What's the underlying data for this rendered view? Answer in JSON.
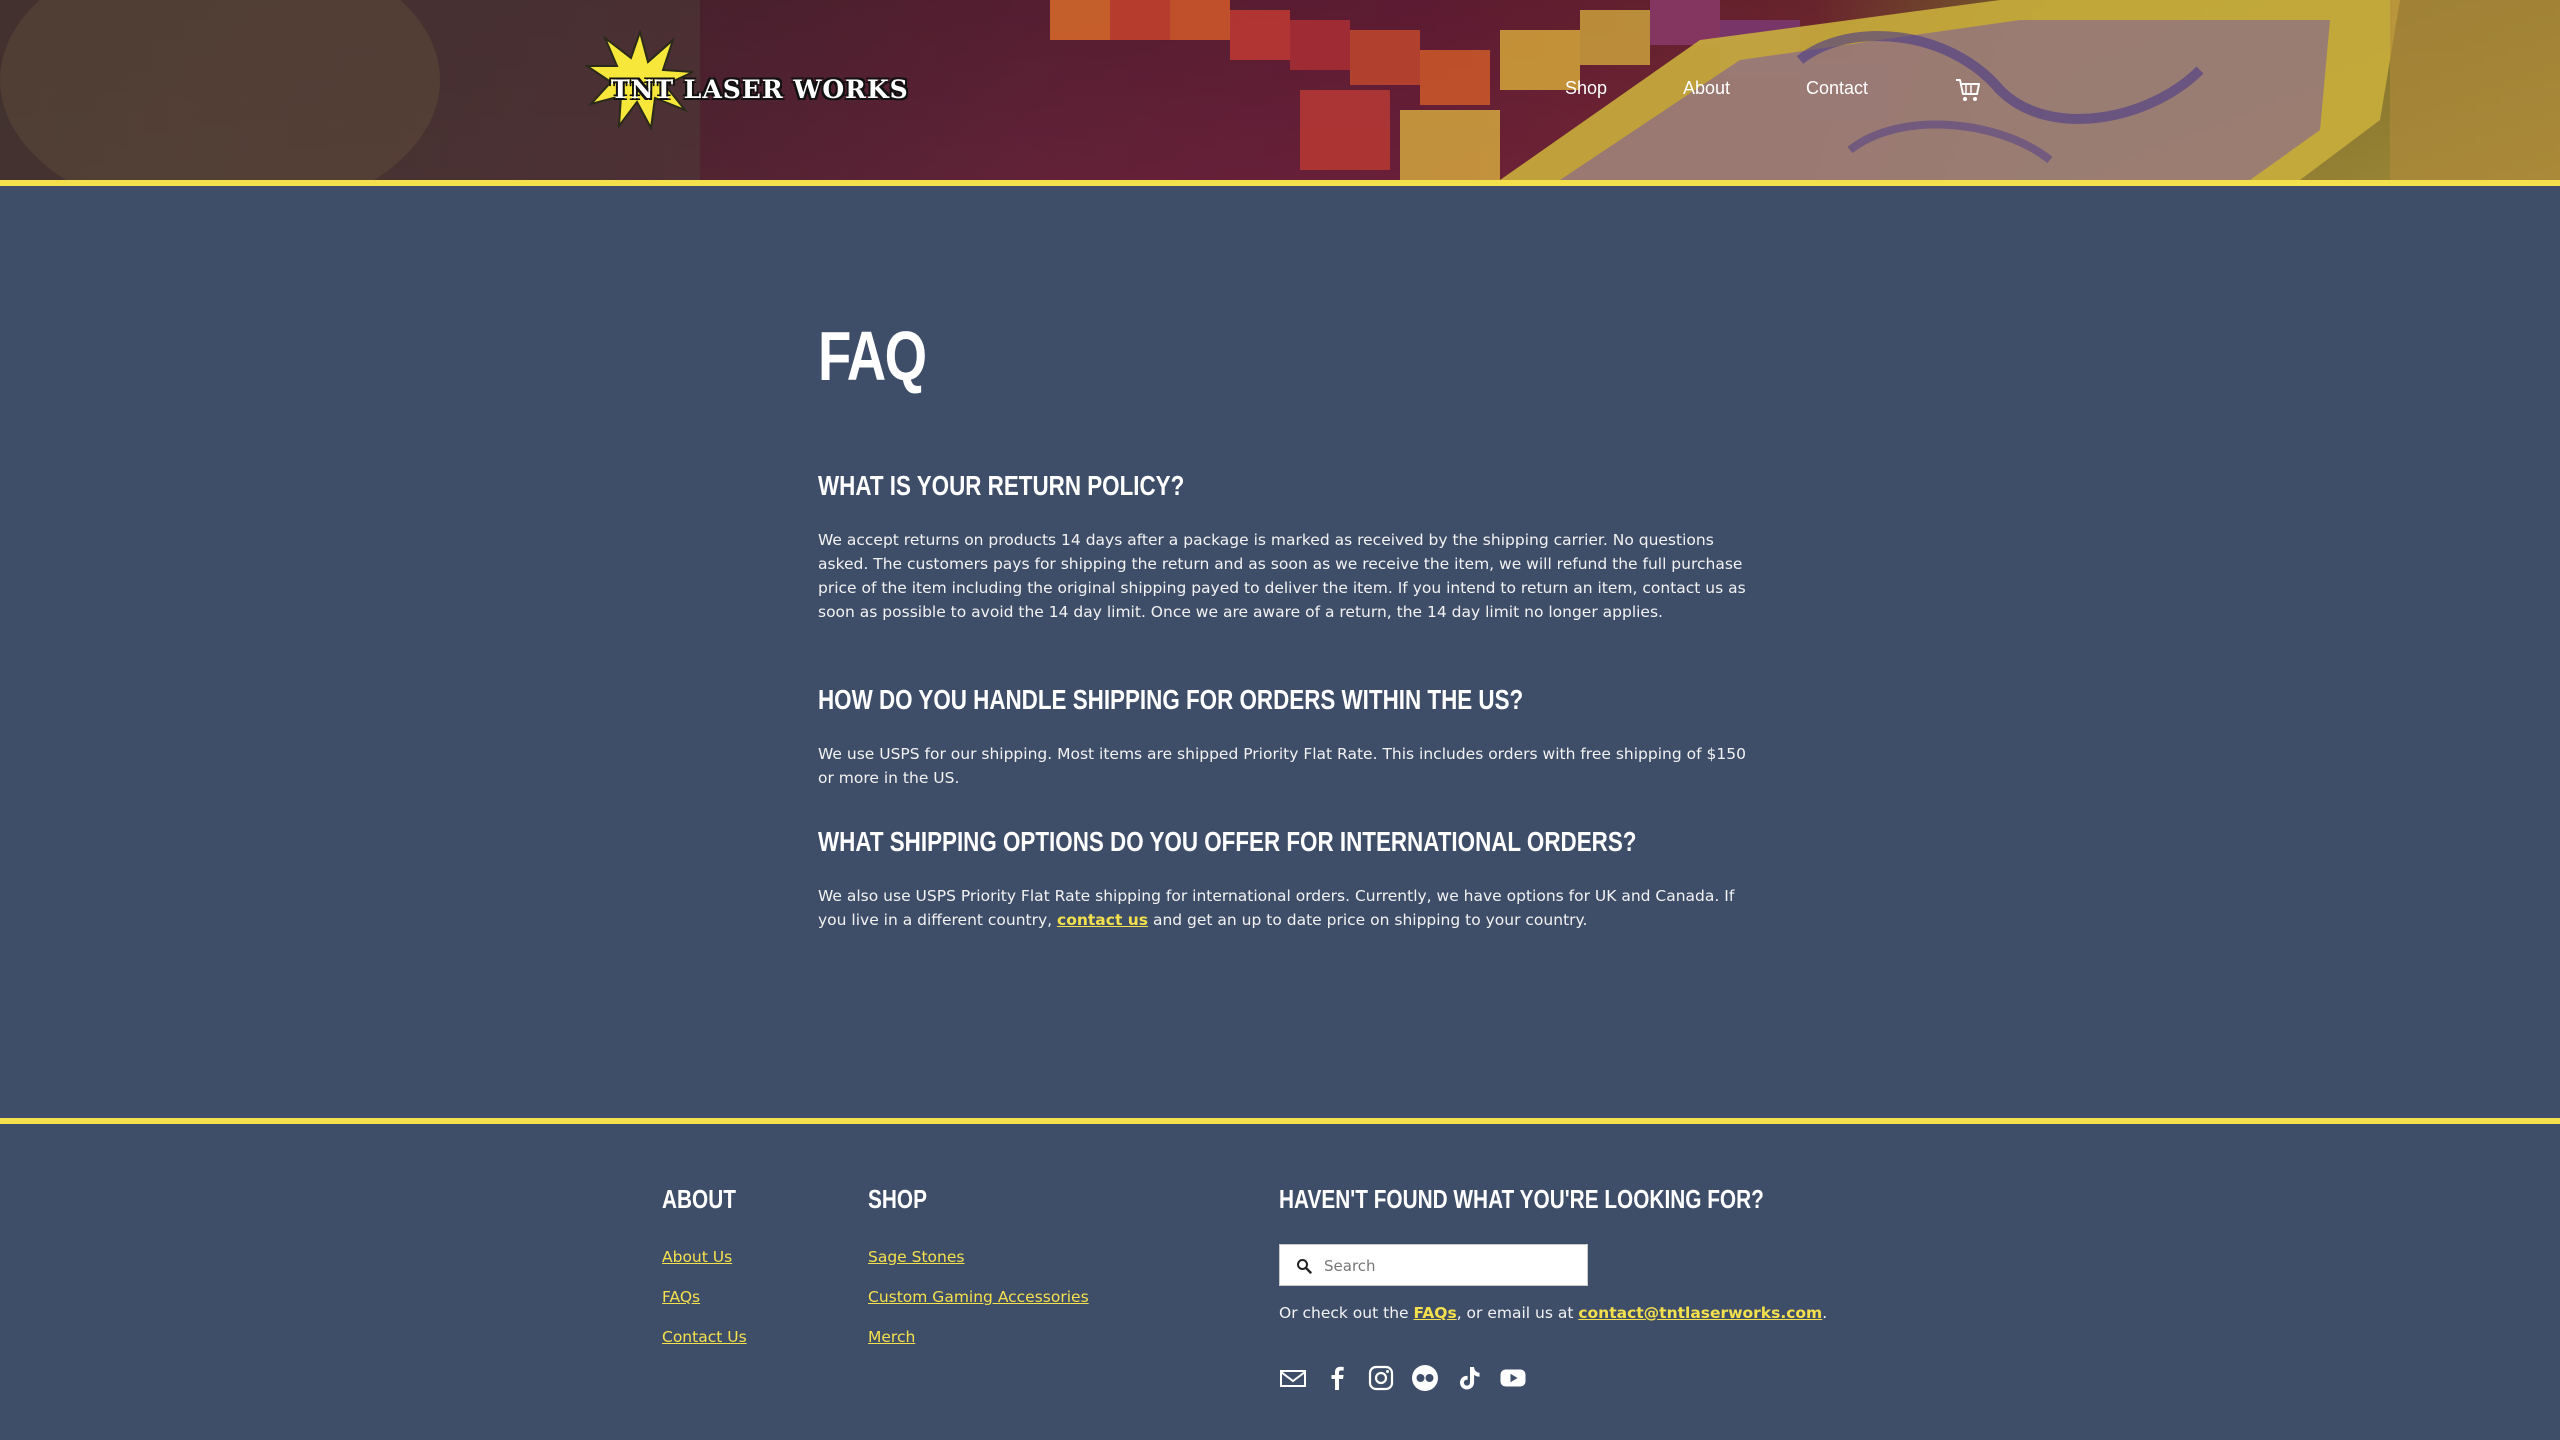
{
  "header": {
    "logo_text": "TNT LASER WORKS",
    "nav": [
      {
        "label": "Shop"
      },
      {
        "label": "About"
      },
      {
        "label": "Contact"
      }
    ],
    "cart_icon": "shopping-cart-icon"
  },
  "main": {
    "title": "FAQ",
    "faqs": [
      {
        "question": "WHAT IS YOUR RETURN POLICY?",
        "answer": "We accept returns on products 14 days after a package is marked as received by the shipping carrier. No questions asked. The customers pays for shipping the return and as soon as we receive the item, we will refund the full purchase price of the item including the original shipping payed to deliver the item. If you intend to return an item, contact us as soon as possible to avoid the 14 day limit. Once we are aware of a return, the 14 day limit no longer applies."
      },
      {
        "question": "HOW DO YOU HANDLE SHIPPING FOR ORDERS WITHIN THE US?",
        "answer": "We use USPS for our shipping. Most items are shipped Priority Flat Rate. This includes orders with free shipping of $150 or more in the US."
      },
      {
        "question": "WHAT SHIPPING OPTIONS DO YOU OFFER FOR INTERNATIONAL ORDERS?",
        "answer_before": "We also use USPS Priority Flat Rate shipping for international orders. Currently, we have options for UK and Canada. If you live in a different country, ",
        "answer_link": "contact us",
        "answer_after": " and get an up to date price on shipping to your country."
      }
    ]
  },
  "footer": {
    "about": {
      "title": "ABOUT",
      "links": [
        "About Us",
        "FAQs",
        "Contact Us"
      ]
    },
    "shop": {
      "title": "SHOP",
      "links": [
        "Sage Stones",
        "Custom Gaming Accessories",
        "Merch"
      ]
    },
    "help": {
      "title": "HAVEN'T FOUND WHAT YOU'RE LOOKING FOR?",
      "search_placeholder": "Search",
      "note_before": "Or check out the ",
      "note_link": "FAQs",
      "note_middle": ", or email us at ",
      "note_email": "contact@tntlaserworks.com",
      "note_after": "."
    },
    "social_icons": [
      "email-icon",
      "facebook-icon",
      "instagram-icon",
      "flickr-icon",
      "tiktok-icon",
      "youtube-icon"
    ]
  },
  "colors": {
    "accent": "#f4e04d",
    "background": "#3f4e68",
    "text": "#ffffff"
  }
}
